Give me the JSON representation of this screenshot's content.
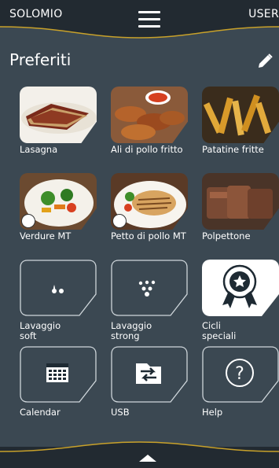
{
  "header": {
    "brand": "SOLOMIO",
    "user": "USER"
  },
  "page": {
    "title": "Preferiti"
  },
  "tiles": [
    {
      "label": "Lasagna",
      "icon": "lasagna-photo"
    },
    {
      "label": "Ali di pollo fritto",
      "icon": "chicken-wings-photo"
    },
    {
      "label": "Patatine fritte",
      "icon": "french-fries-photo"
    },
    {
      "label": "Verdure MT",
      "icon": "vegetables-photo"
    },
    {
      "label": "Petto di pollo MT",
      "icon": "chicken-breast-photo"
    },
    {
      "label": "Polpettone",
      "icon": "meatloaf-photo"
    },
    {
      "label": "Lavaggio soft",
      "icon": "two-drops-icon"
    },
    {
      "label": "Lavaggio strong",
      "icon": "many-drops-icon"
    },
    {
      "label": "Cicli speciali",
      "icon": "award-badge-icon"
    },
    {
      "label": "Calendar",
      "icon": "calendar-icon"
    },
    {
      "label": "USB",
      "icon": "usb-transfer-icon"
    },
    {
      "label": "Help",
      "icon": "help-icon"
    }
  ],
  "colors": {
    "background": "#3b4852",
    "bar": "#222a31",
    "accent": "#c8a12a"
  }
}
